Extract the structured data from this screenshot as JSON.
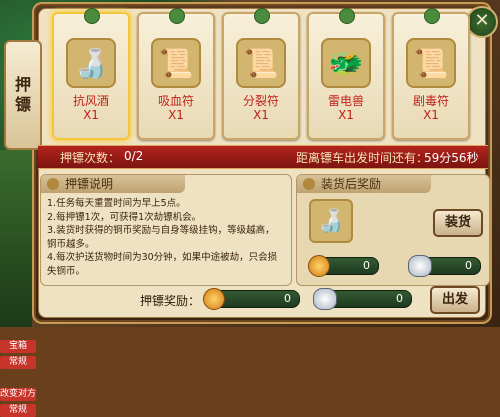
{
  "side_tab": {
    "label_1": "押",
    "label_2": "镖"
  },
  "left_strip": {
    "labels": [
      "宝箱",
      "常规",
      "改变对方",
      "常规"
    ]
  },
  "close_button": {
    "glyph": "✕"
  },
  "items": [
    {
      "name": "抗风酒",
      "qty": "X1",
      "icon": "gourd-icon",
      "glyph": "🍶"
    },
    {
      "name": "吸血符",
      "qty": "X1",
      "icon": "talisman-icon",
      "glyph": "📜"
    },
    {
      "name": "分裂符",
      "qty": "X1",
      "icon": "talisman-icon",
      "glyph": "📜"
    },
    {
      "name": "雷电兽",
      "qty": "X1",
      "icon": "beast-icon",
      "glyph": "🐲"
    },
    {
      "name": "剧毒符",
      "qty": "X1",
      "icon": "talisman-icon",
      "glyph": "📜"
    }
  ],
  "status_bar": {
    "count_label": "押镖次数：",
    "count_value": "0/2",
    "time_label": "距离镖车出发时间还有：",
    "time_value": "59分56秒"
  },
  "instructions": {
    "title": "押镖说明",
    "lines": [
      "1.任务每天重置时间为早上5点。",
      "2.每押镖1次，可获得1次劫镖机会。",
      "3.装货时获得的铜币奖励与自身等级挂钩，等级越高，",
      "铜币越多。",
      "4.每次护送货物时间为30分钟，如果中途被劫，只会损",
      "失铜币。"
    ]
  },
  "cargo_reward": {
    "title": "装货后奖励",
    "item_glyph": "🍶",
    "load_button": "装货",
    "copper": "0",
    "silver": "0"
  },
  "escort_reward": {
    "label": "押镖奖励：",
    "copper": "0",
    "silver": "0"
  },
  "depart_button": "出发",
  "colors": {
    "accent_red": "#c0221a",
    "bar_red": "#b4241d",
    "panel_bg": "#efe2c2"
  }
}
